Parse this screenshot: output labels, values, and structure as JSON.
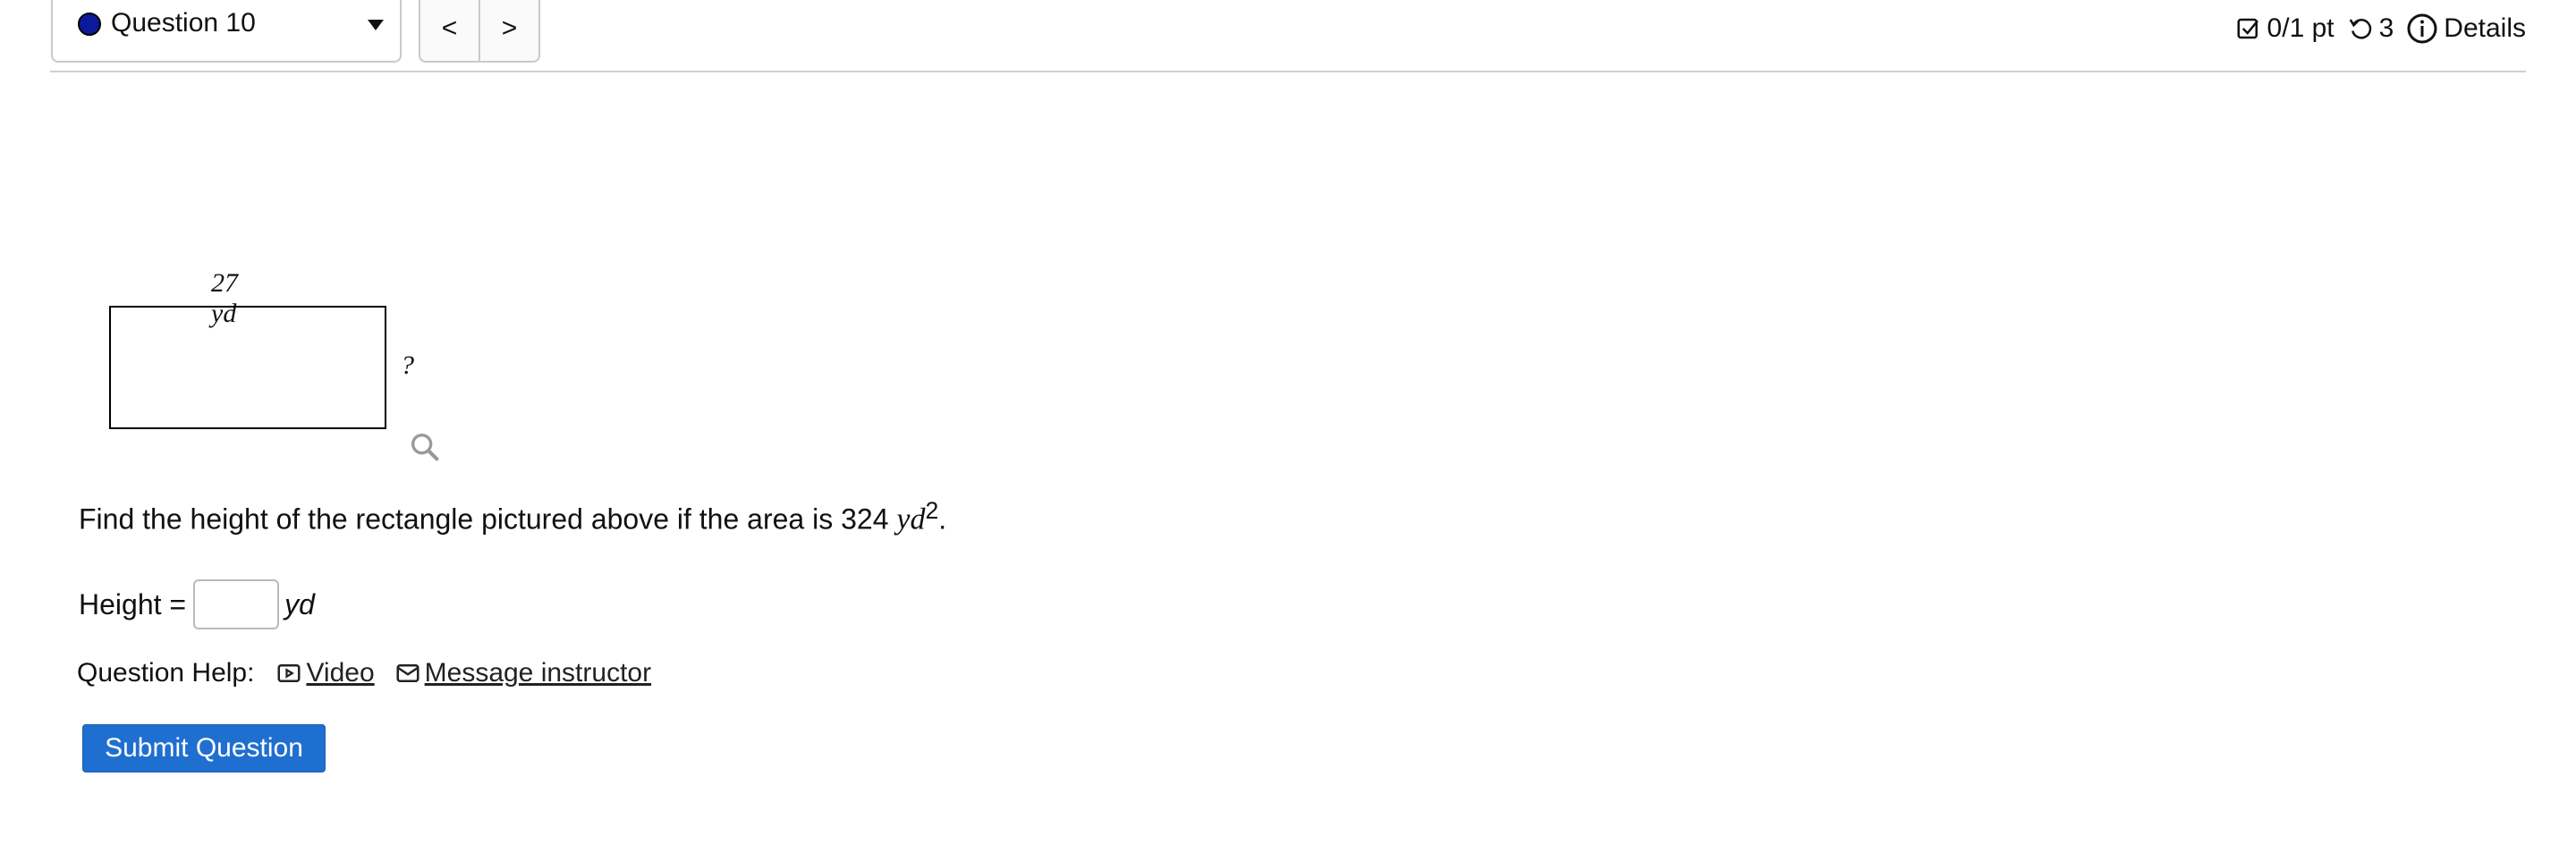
{
  "question_selector": {
    "label": "Question 10",
    "dot_color": "#0a1a9a"
  },
  "nav": {
    "prev": "<",
    "next": ">"
  },
  "status": {
    "score": "0/1 pt",
    "attempts": "3",
    "details": "Details"
  },
  "figure": {
    "top_label": "27 yd",
    "side_label": "?"
  },
  "problem": {
    "prefix": "Find the height of the rectangle pictured above if the area is 324 ",
    "unit_math": "yd",
    "exponent": "2",
    "suffix": "."
  },
  "answer": {
    "label": "Height =",
    "value": "",
    "unit": "yd"
  },
  "help": {
    "label": "Question Help:",
    "video": "Video",
    "message": "Message instructor"
  },
  "submit_label": "Submit Question",
  "colors": {
    "primary": "#1f6fd1",
    "dot": "#0a1a9a"
  }
}
